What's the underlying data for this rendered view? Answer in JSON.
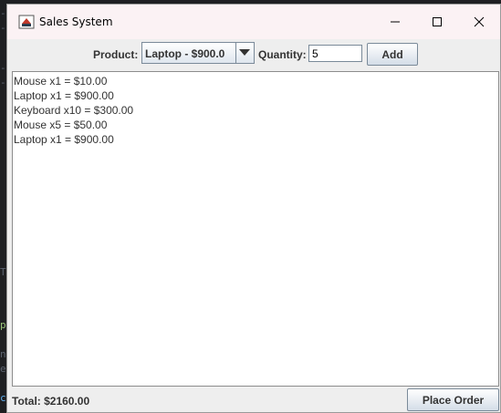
{
  "window": {
    "title": "Sales System",
    "icon": "java-cup-icon"
  },
  "titlebar_buttons": {
    "minimize": "minimize-icon",
    "maximize": "maximize-icon",
    "close": "close-icon"
  },
  "toolbar": {
    "product_label": "Product:",
    "product_selected": "Laptop - $900.0",
    "quantity_label": "Quantity:",
    "quantity_value": "5",
    "add_label": "Add"
  },
  "orders": [
    "Mouse x1 = $10.00",
    "Laptop x1 = $900.00",
    "Keyboard x10 = $300.00",
    "Mouse x5 = $50.00",
    "Laptop x1 = $900.00"
  ],
  "footer": {
    "total": "Total: $2160.00",
    "place_order_label": "Place Order"
  },
  "colors": {
    "titlebar": "#fbf2f4",
    "window_bg": "#eeeeee",
    "button_gradient_bottom": "#d4dde8",
    "border": "#7a8a99"
  }
}
